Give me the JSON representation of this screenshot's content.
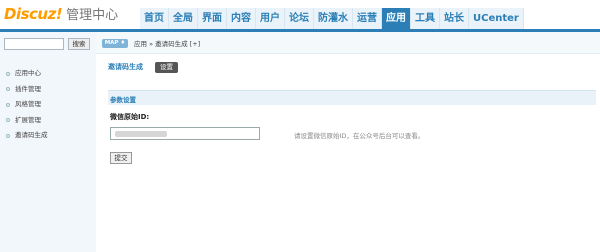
{
  "header": {
    "logo": "Discuz!",
    "subtitle": "管理中心",
    "nav": [
      {
        "label": "首页",
        "active": false
      },
      {
        "label": "全局",
        "active": false
      },
      {
        "label": "界面",
        "active": false
      },
      {
        "label": "内容",
        "active": false
      },
      {
        "label": "用户",
        "active": false
      },
      {
        "label": "论坛",
        "active": false
      },
      {
        "label": "防灌水",
        "active": false
      },
      {
        "label": "运营",
        "active": false
      },
      {
        "label": "应用",
        "active": true
      },
      {
        "label": "工具",
        "active": false
      },
      {
        "label": "站长",
        "active": false
      },
      {
        "label": "UCenter",
        "active": false
      }
    ]
  },
  "sidebar": {
    "search_button": "搜索",
    "items": [
      "应用中心",
      "插件管理",
      "风格管理",
      "扩展管理",
      "邀请码生成"
    ]
  },
  "breadcrumb": {
    "map_label": "MAP ♦",
    "path": "应用 » 邀请码生成 [+]"
  },
  "page": {
    "title": "邀请码生成",
    "tab": "设置",
    "section_title": "参数设置",
    "field_label": "微信原始ID:",
    "field_hint": "请设置微信原始ID，在公众号后台可以查看。",
    "submit": "提交"
  }
}
